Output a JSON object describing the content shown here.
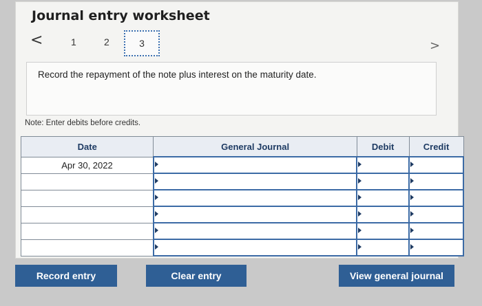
{
  "header": {
    "title": "Journal entry worksheet"
  },
  "nav": {
    "prev_glyph": "<",
    "next_glyph": ">",
    "steps": [
      "1",
      "2",
      "3"
    ],
    "active_step": "3"
  },
  "instruction": "Record the repayment of the note plus interest on the maturity date.",
  "note": "Note: Enter debits before credits.",
  "table": {
    "headers": {
      "date": "Date",
      "journal": "General Journal",
      "debit": "Debit",
      "credit": "Credit"
    },
    "rows": [
      {
        "date": "Apr 30, 2022",
        "journal": "",
        "debit": "",
        "credit": ""
      },
      {
        "date": "",
        "journal": "",
        "debit": "",
        "credit": ""
      },
      {
        "date": "",
        "journal": "",
        "debit": "",
        "credit": ""
      },
      {
        "date": "",
        "journal": "",
        "debit": "",
        "credit": ""
      },
      {
        "date": "",
        "journal": "",
        "debit": "",
        "credit": ""
      },
      {
        "date": "",
        "journal": "",
        "debit": "",
        "credit": ""
      }
    ]
  },
  "buttons": {
    "record": "Record entry",
    "clear": "Clear entry",
    "view": "View general journal"
  },
  "colors": {
    "button": "#2f5f95",
    "header_text": "#1e3b63",
    "input_border": "#3b6aa5"
  }
}
